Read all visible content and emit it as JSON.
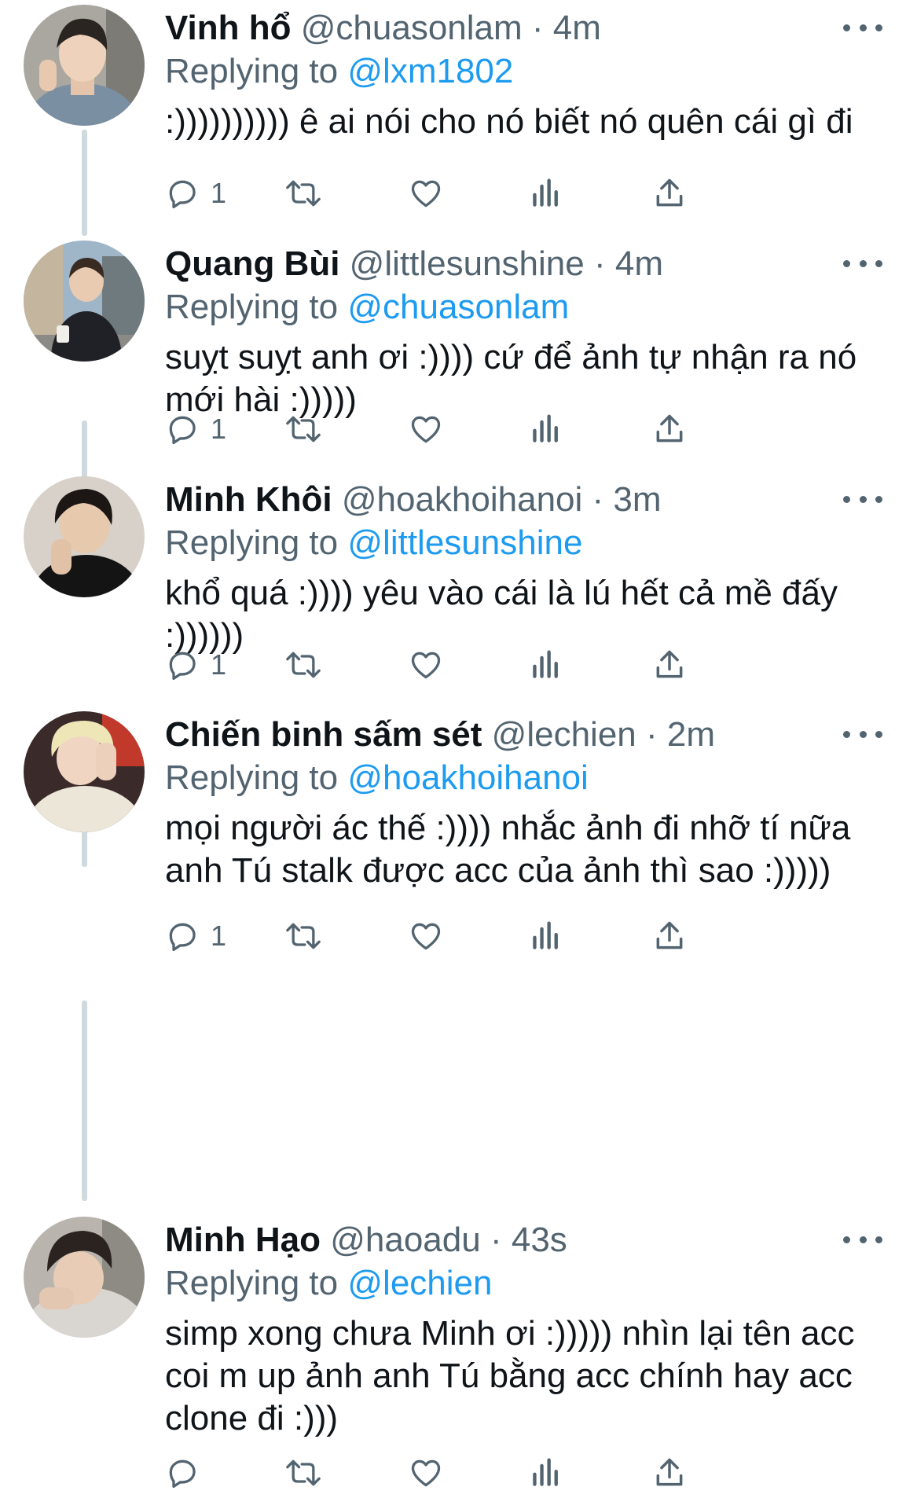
{
  "tweets": [
    {
      "name": "Vinh hổ",
      "handle": "@chuasonlam",
      "separator": "·",
      "time": "4m",
      "replying_label": "Replying to",
      "replying_to": "@lxm1802",
      "text": ":)))))))))) ê ai nói cho nó biết nó quên cái gì đi",
      "reply_count": "1",
      "avatar_icon": "avatar-photo"
    },
    {
      "name": "Quang Bùi",
      "handle": "@littlesunshine",
      "separator": "·",
      "time": "4m",
      "replying_label": "Replying to",
      "replying_to": "@chuasonlam",
      "text": "suỵt suỵt anh ơi :)))) cứ để ảnh tự nhận ra nó mới hài :)))))",
      "reply_count": "1",
      "avatar_icon": "avatar-photo"
    },
    {
      "name": "Minh Khôi",
      "handle": "@hoakhoihanoi",
      "separator": "·",
      "time": "3m",
      "replying_label": "Replying to",
      "replying_to": "@littlesunshine",
      "text": "khổ quá :)))) yêu vào cái là lú hết cả mề đấy :))))))",
      "reply_count": "1",
      "avatar_icon": "avatar-photo"
    },
    {
      "name": "Chiến binh sấm sét",
      "handle": "@lechien",
      "separator": "·",
      "time": "2m",
      "replying_label": "Replying to",
      "replying_to": "@hoakhoihanoi",
      "text": "mọi người ác thế :)))) nhắc ảnh đi nhỡ tí nữa anh Tú stalk được acc của ảnh thì sao :)))))",
      "reply_count": "1",
      "avatar_icon": "avatar-photo"
    },
    {
      "name": "Minh Hạo",
      "handle": "@haoadu",
      "separator": "·",
      "time": "43s",
      "replying_label": "Replying to",
      "replying_to": "@lechien",
      "text": "simp xong chưa Minh ơi :))))) nhìn lại tên acc coi m up ảnh anh Tú bằng acc chính hay acc clone đi :)))",
      "reply_count": "",
      "avatar_icon": "avatar-photo"
    }
  ],
  "icons": {
    "reply": "reply-icon",
    "retweet": "retweet-icon",
    "like": "like-icon",
    "views": "views-icon",
    "share": "share-icon",
    "more": "more-icon"
  },
  "colors": {
    "text": "#0f1419",
    "secondary": "#536471",
    "mention": "#1d9bf0",
    "thread_line": "#cfd9de"
  }
}
